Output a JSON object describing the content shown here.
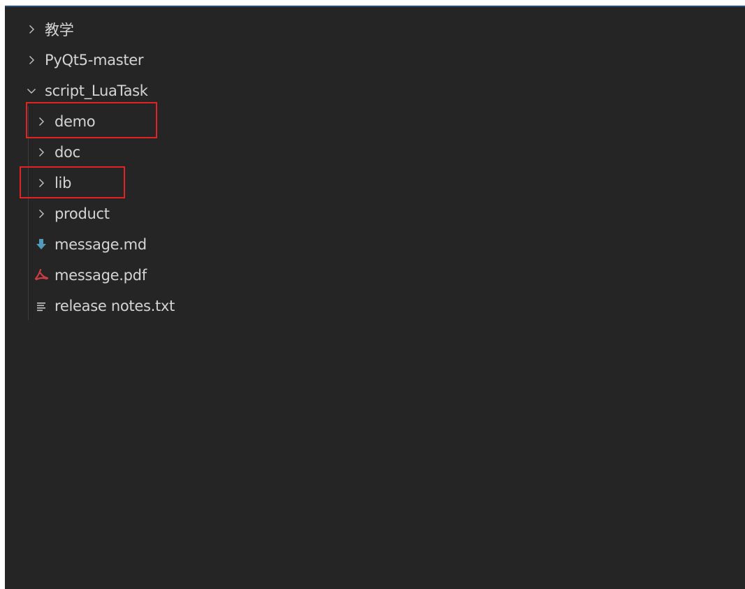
{
  "explorer": {
    "items": [
      {
        "label": "教学",
        "type": "folder",
        "expanded": false,
        "depth": 0
      },
      {
        "label": "PyQt5-master",
        "type": "folder",
        "expanded": false,
        "depth": 0
      },
      {
        "label": "script_LuaTask",
        "type": "folder",
        "expanded": true,
        "depth": 0
      },
      {
        "label": "demo",
        "type": "folder",
        "expanded": false,
        "depth": 1,
        "highlighted": true
      },
      {
        "label": "doc",
        "type": "folder",
        "expanded": false,
        "depth": 1
      },
      {
        "label": "lib",
        "type": "folder",
        "expanded": false,
        "depth": 1,
        "highlighted": true
      },
      {
        "label": "product",
        "type": "folder",
        "expanded": false,
        "depth": 1
      },
      {
        "label": "message.md",
        "type": "file",
        "icon": "markdown-file-icon",
        "depth": 1
      },
      {
        "label": "message.pdf",
        "type": "file",
        "icon": "pdf-file-icon",
        "depth": 1
      },
      {
        "label": "release notes.txt",
        "type": "file",
        "icon": "text-file-icon",
        "depth": 1
      }
    ]
  },
  "colors": {
    "background": "#252526",
    "text": "#d4d4d4",
    "highlight_border": "#e02424",
    "markdown_icon": "#519aba",
    "pdf_icon": "#cc3e44"
  }
}
